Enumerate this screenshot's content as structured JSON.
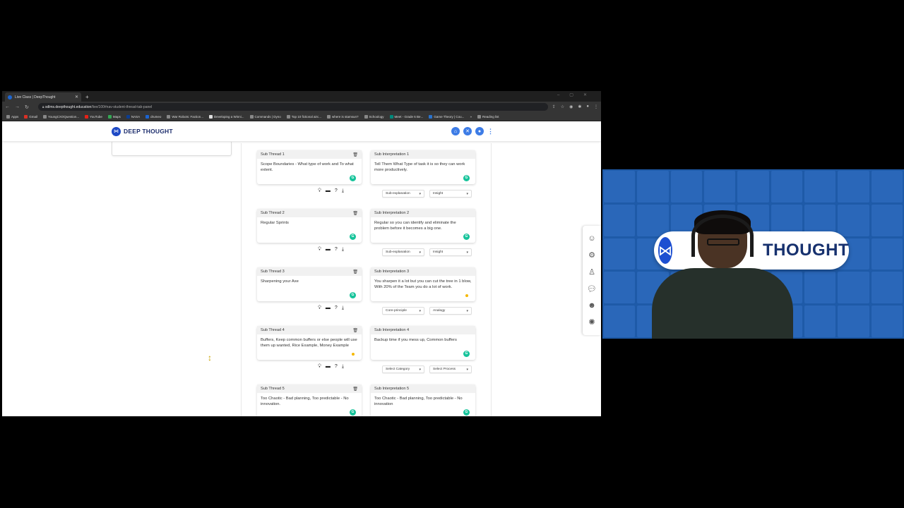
{
  "browser": {
    "tab_title": "Live Class | DeepThought",
    "url_host": "sdlms.deepthought.education",
    "url_path": "/live/100#nav-student-thread-tab-panel",
    "bookmarks": [
      "Apps",
      "Gmail",
      "YoungCXOQuestion...",
      "YouTube",
      "Maps",
      "NASA",
      "drumeo",
      "War Robots: Faction...",
      "Developing a Winni...",
      "Commands | Dyno",
      "Top 10 fictional airc...",
      "where is stamsun?",
      "Schoology",
      "Meet - Grade 6 Be...",
      "Game Theory | Cou..."
    ],
    "reading_list": "Reading list"
  },
  "app": {
    "logo_text": "DEEP THOUGHT",
    "header_icons": [
      "home-icon",
      "close-icon",
      "bell-icon"
    ]
  },
  "threads": [
    {
      "thread_title": "Sub Thread 1",
      "thread_text": "Scope Boundaries - What type of work and To what extent.",
      "interp_title": "Sub Interpretation 1",
      "interp_text": "Tell Them What Type of task it is so they can work more productively.",
      "select1": "Sub-explanation",
      "select2": "Insight"
    },
    {
      "thread_title": "Sub Thread 2",
      "thread_text": "Regular Sprints",
      "interp_title": "Sub Interpretation 2",
      "interp_text": "Regular so you can identify and eliminate the problem before it becomes a big one.",
      "select1": "Sub-explanation",
      "select2": "Insight"
    },
    {
      "thread_title": "Sub Thread 3",
      "thread_text": "Sharpening your Axe",
      "interp_title": "Sub Interpretation 3",
      "interp_text": "You sharpen it a lot but you can cut the tree in 1 blow, With 20% of the Team you do a lot of work.",
      "select1": "Core-principle",
      "select2": "Analogy"
    },
    {
      "thread_title": "Sub Thread 4",
      "thread_text": "Buffers, Keep common buffers or else people will use them up wanted, Rice Example, Money Example",
      "interp_title": "Sub Interpretation 4",
      "interp_text": "Backup time if you mess up, Common buffers",
      "select1": "Select Category",
      "select2": "Select Process"
    },
    {
      "thread_title": "Sub Thread 5",
      "thread_text": "Too Chaotic - Bad planning, Too predictable - No innovation.",
      "interp_title": "Sub Interpretation 5",
      "interp_text": "Too Chaotic - Bad planning, Too predictable - No innovation",
      "select1": "",
      "select2": ""
    }
  ],
  "webcam": {
    "banner_text": "THOUGHT"
  }
}
